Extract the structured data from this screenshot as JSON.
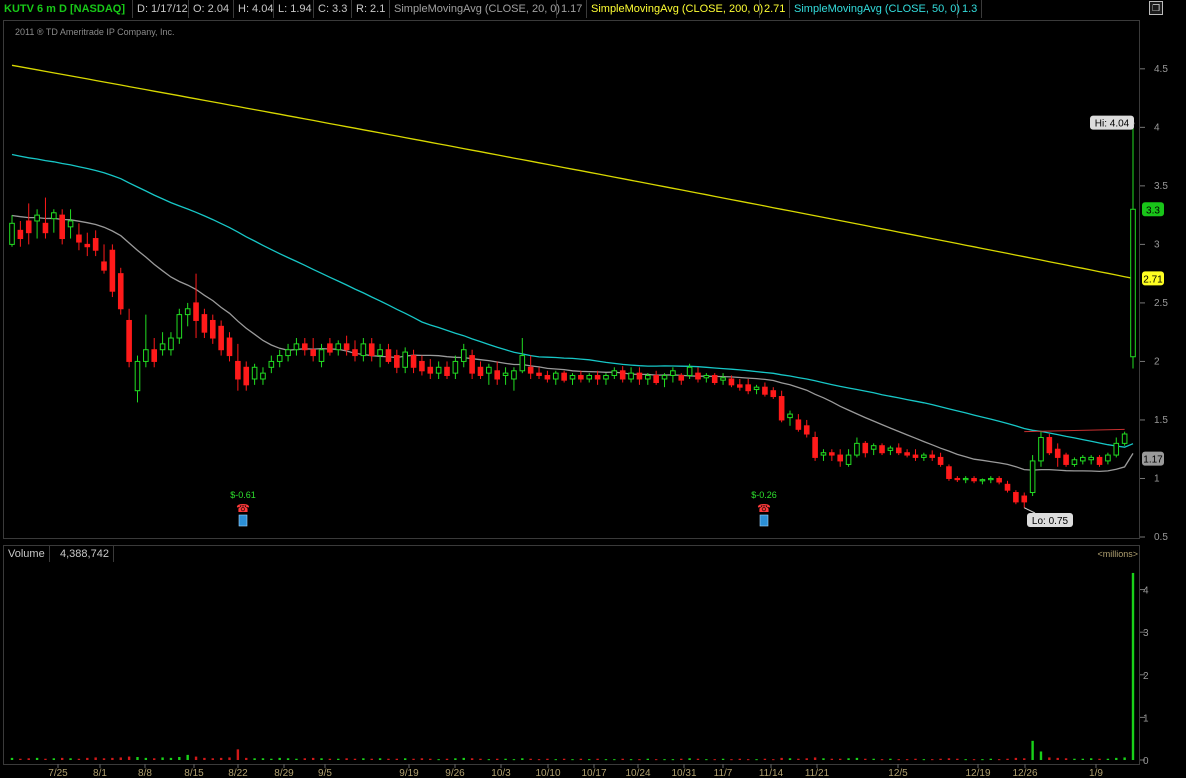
{
  "header": {
    "symbol": "KUTV 6 m D [NASDAQ]",
    "date": "D: 1/17/12",
    "open": "O: 2.04",
    "high": "H: 4.04",
    "low": "L: 1.94",
    "close": "C: 3.3",
    "range": "R: 2.1",
    "sma20_label": "SimpleMovingAvg (CLOSE, 20, 0)",
    "sma20_value": "1.17",
    "sma200_label": "SimpleMovingAvg (CLOSE, 200, 0)",
    "sma200_value": "2.71",
    "sma50_label": "SimpleMovingAvg (CLOSE, 50, 0)",
    "sma50_value": "1.3",
    "restore_icon": "restore-window-icon"
  },
  "colors": {
    "up": "#22dd22",
    "down": "#ff1a1a",
    "sma20": "#9a9a9a",
    "sma50": "#17c7c7",
    "sma200": "#d8d800",
    "volume_up": "#19d119",
    "volume_down": "#d11919",
    "symbol": "#18c818",
    "sma200_label": "#ffff33",
    "sma50_label": "#33dddd"
  },
  "copyright": "2011 ® TD Ameritrade IP Company, Inc.",
  "price_axis": {
    "min": 0.5,
    "max": 4.9,
    "ticks": [
      "0.5",
      "1",
      "1.5",
      "2",
      "2.5",
      "3",
      "3.5",
      "4",
      "4.5"
    ],
    "tags": [
      {
        "label": "Hi: 4.04",
        "value": 4.04
      },
      {
        "label": "3.3",
        "value": 3.3
      },
      {
        "label": "2.71",
        "value": 2.71
      },
      {
        "label": "1.17",
        "value": 1.17
      }
    ],
    "lo_label": "Lo: 0.75"
  },
  "earnings": [
    {
      "label": "$-0.61",
      "date": "8/22",
      "icon": "earnings-phone-icon"
    },
    {
      "label": "$-0.26",
      "date": "11/14",
      "icon": "earnings-phone-icon"
    }
  ],
  "volume_pane": {
    "title": "Volume",
    "value": "4,388,742",
    "units": "<millions>",
    "ticks": [
      "0",
      "1",
      "2",
      "3",
      "4"
    ],
    "max": 4.6
  },
  "x_axis": {
    "labels": [
      "7/25",
      "8/1",
      "8/8",
      "8/15",
      "8/22",
      "8/29",
      "9/5",
      "9/19",
      "9/26",
      "10/3",
      "10/10",
      "10/17",
      "10/24",
      "10/31",
      "11/7",
      "11/14",
      "11/21",
      "12/5",
      "12/19",
      "12/26",
      "1/9"
    ]
  },
  "chart_data": {
    "type": "candlestick",
    "title": "KUTV 6 m D [NASDAQ]",
    "ylim": [
      0.5,
      4.9
    ],
    "x_start": "2011-07-20",
    "candles": [
      [
        3.0,
        3.25,
        2.98,
        3.18
      ],
      [
        3.12,
        3.2,
        2.98,
        3.05
      ],
      [
        3.2,
        3.35,
        3.0,
        3.1
      ],
      [
        3.2,
        3.3,
        3.05,
        3.25
      ],
      [
        3.18,
        3.4,
        3.05,
        3.1
      ],
      [
        3.22,
        3.3,
        3.1,
        3.27
      ],
      [
        3.25,
        3.3,
        3.0,
        3.05
      ],
      [
        3.15,
        3.3,
        3.05,
        3.2
      ],
      [
        3.08,
        3.18,
        2.95,
        3.02
      ],
      [
        3.0,
        3.1,
        2.9,
        2.98
      ],
      [
        3.05,
        3.12,
        2.9,
        2.95
      ],
      [
        2.85,
        3.0,
        2.75,
        2.78
      ],
      [
        2.95,
        3.0,
        2.55,
        2.6
      ],
      [
        2.75,
        2.8,
        2.4,
        2.45
      ],
      [
        2.35,
        2.45,
        1.95,
        2.0
      ],
      [
        1.75,
        2.05,
        1.65,
        2.0
      ],
      [
        2.0,
        2.4,
        1.95,
        2.1
      ],
      [
        2.1,
        2.2,
        1.95,
        2.0
      ],
      [
        2.1,
        2.25,
        2.05,
        2.15
      ],
      [
        2.1,
        2.25,
        2.05,
        2.2
      ],
      [
        2.2,
        2.45,
        2.15,
        2.4
      ],
      [
        2.4,
        2.5,
        2.3,
        2.45
      ],
      [
        2.5,
        2.75,
        2.2,
        2.35
      ],
      [
        2.4,
        2.45,
        2.2,
        2.25
      ],
      [
        2.35,
        2.4,
        2.15,
        2.2
      ],
      [
        2.3,
        2.35,
        2.05,
        2.1
      ],
      [
        2.2,
        2.25,
        2.0,
        2.05
      ],
      [
        2.0,
        2.15,
        1.75,
        1.85
      ],
      [
        1.95,
        2.0,
        1.75,
        1.8
      ],
      [
        1.85,
        1.98,
        1.8,
        1.95
      ],
      [
        1.85,
        1.95,
        1.8,
        1.9
      ],
      [
        1.95,
        2.05,
        1.9,
        2.0
      ],
      [
        2.0,
        2.1,
        1.95,
        2.05
      ],
      [
        2.05,
        2.15,
        2.0,
        2.1
      ],
      [
        2.1,
        2.2,
        2.05,
        2.15
      ],
      [
        2.15,
        2.2,
        2.05,
        2.1
      ],
      [
        2.1,
        2.2,
        2.0,
        2.05
      ],
      [
        2.0,
        2.15,
        1.95,
        2.1
      ],
      [
        2.15,
        2.2,
        2.05,
        2.08
      ],
      [
        2.1,
        2.18,
        2.05,
        2.15
      ],
      [
        2.15,
        2.22,
        2.05,
        2.1
      ],
      [
        2.1,
        2.18,
        2.0,
        2.05
      ],
      [
        2.05,
        2.2,
        2.0,
        2.15
      ],
      [
        2.15,
        2.2,
        2.0,
        2.05
      ],
      [
        2.05,
        2.15,
        1.95,
        2.1
      ],
      [
        2.1,
        2.15,
        1.98,
        2.0
      ],
      [
        2.05,
        2.1,
        1.9,
        1.95
      ],
      [
        1.95,
        2.12,
        1.9,
        2.08
      ],
      [
        2.05,
        2.1,
        1.9,
        1.95
      ],
      [
        2.0,
        2.05,
        1.88,
        1.92
      ],
      [
        1.95,
        2.02,
        1.85,
        1.9
      ],
      [
        1.9,
        2.0,
        1.85,
        1.95
      ],
      [
        1.95,
        2.0,
        1.85,
        1.88
      ],
      [
        1.9,
        2.05,
        1.85,
        2.0
      ],
      [
        2.0,
        2.15,
        1.95,
        2.1
      ],
      [
        2.05,
        2.1,
        1.85,
        1.9
      ],
      [
        1.95,
        2.0,
        1.85,
        1.88
      ],
      [
        1.9,
        1.98,
        1.8,
        1.95
      ],
      [
        1.92,
        2.0,
        1.8,
        1.85
      ],
      [
        1.88,
        1.95,
        1.8,
        1.9
      ],
      [
        1.85,
        1.95,
        1.75,
        1.92
      ],
      [
        1.92,
        2.2,
        1.9,
        2.05
      ],
      [
        1.95,
        2.05,
        1.85,
        1.9
      ],
      [
        1.9,
        1.95,
        1.85,
        1.88
      ],
      [
        1.88,
        1.92,
        1.82,
        1.85
      ],
      [
        1.85,
        1.92,
        1.8,
        1.9
      ],
      [
        1.9,
        1.92,
        1.82,
        1.84
      ],
      [
        1.85,
        1.9,
        1.8,
        1.88
      ],
      [
        1.88,
        1.92,
        1.82,
        1.85
      ],
      [
        1.85,
        1.9,
        1.82,
        1.88
      ],
      [
        1.88,
        1.92,
        1.8,
        1.85
      ],
      [
        1.85,
        1.9,
        1.8,
        1.88
      ],
      [
        1.88,
        1.95,
        1.85,
        1.92
      ],
      [
        1.92,
        1.96,
        1.82,
        1.85
      ],
      [
        1.85,
        1.95,
        1.82,
        1.9
      ],
      [
        1.9,
        1.95,
        1.8,
        1.85
      ],
      [
        1.85,
        1.9,
        1.8,
        1.88
      ],
      [
        1.88,
        1.92,
        1.8,
        1.82
      ],
      [
        1.85,
        1.9,
        1.78,
        1.88
      ],
      [
        1.88,
        1.95,
        1.82,
        1.92
      ],
      [
        1.88,
        1.9,
        1.8,
        1.84
      ],
      [
        1.88,
        1.98,
        1.85,
        1.95
      ],
      [
        1.9,
        1.95,
        1.82,
        1.85
      ],
      [
        1.86,
        1.9,
        1.82,
        1.88
      ],
      [
        1.88,
        1.9,
        1.8,
        1.82
      ],
      [
        1.84,
        1.9,
        1.8,
        1.86
      ],
      [
        1.85,
        1.88,
        1.78,
        1.8
      ],
      [
        1.8,
        1.85,
        1.75,
        1.78
      ],
      [
        1.8,
        1.85,
        1.72,
        1.75
      ],
      [
        1.76,
        1.8,
        1.72,
        1.78
      ],
      [
        1.78,
        1.82,
        1.7,
        1.72
      ],
      [
        1.75,
        1.78,
        1.68,
        1.7
      ],
      [
        1.7,
        1.75,
        1.48,
        1.5
      ],
      [
        1.52,
        1.58,
        1.45,
        1.55
      ],
      [
        1.5,
        1.55,
        1.4,
        1.42
      ],
      [
        1.45,
        1.5,
        1.35,
        1.38
      ],
      [
        1.35,
        1.4,
        1.15,
        1.18
      ],
      [
        1.2,
        1.25,
        1.15,
        1.22
      ],
      [
        1.22,
        1.25,
        1.15,
        1.2
      ],
      [
        1.2,
        1.25,
        1.1,
        1.15
      ],
      [
        1.12,
        1.25,
        1.1,
        1.2
      ],
      [
        1.2,
        1.35,
        1.18,
        1.3
      ],
      [
        1.3,
        1.32,
        1.18,
        1.22
      ],
      [
        1.25,
        1.3,
        1.2,
        1.28
      ],
      [
        1.28,
        1.3,
        1.2,
        1.22
      ],
      [
        1.24,
        1.28,
        1.2,
        1.26
      ],
      [
        1.26,
        1.3,
        1.2,
        1.22
      ],
      [
        1.22,
        1.25,
        1.18,
        1.2
      ],
      [
        1.2,
        1.25,
        1.15,
        1.18
      ],
      [
        1.18,
        1.22,
        1.15,
        1.2
      ],
      [
        1.2,
        1.24,
        1.15,
        1.18
      ],
      [
        1.18,
        1.22,
        1.1,
        1.12
      ],
      [
        1.1,
        1.12,
        0.98,
        1.0
      ],
      [
        1.0,
        1.02,
        0.97,
        0.99
      ],
      [
        0.99,
        1.02,
        0.96,
        1.0
      ],
      [
        1.0,
        1.02,
        0.96,
        0.98
      ],
      [
        0.98,
        1.0,
        0.95,
        0.99
      ],
      [
        0.99,
        1.02,
        0.96,
        1.0
      ],
      [
        1.0,
        1.02,
        0.95,
        0.97
      ],
      [
        0.95,
        0.98,
        0.88,
        0.9
      ],
      [
        0.88,
        0.9,
        0.78,
        0.8
      ],
      [
        0.85,
        0.88,
        0.75,
        0.8
      ],
      [
        0.88,
        1.2,
        0.85,
        1.15
      ],
      [
        1.15,
        1.4,
        1.1,
        1.35
      ],
      [
        1.35,
        1.38,
        1.2,
        1.22
      ],
      [
        1.25,
        1.3,
        1.1,
        1.18
      ],
      [
        1.2,
        1.22,
        1.1,
        1.12
      ],
      [
        1.12,
        1.18,
        1.1,
        1.16
      ],
      [
        1.15,
        1.2,
        1.12,
        1.18
      ],
      [
        1.16,
        1.2,
        1.12,
        1.18
      ],
      [
        1.18,
        1.2,
        1.1,
        1.12
      ],
      [
        1.15,
        1.22,
        1.12,
        1.2
      ],
      [
        1.2,
        1.35,
        1.18,
        1.3
      ],
      [
        1.3,
        1.4,
        1.28,
        1.38
      ],
      [
        2.04,
        4.04,
        1.94,
        3.3
      ]
    ],
    "volume_millions": [
      0.05,
      0.03,
      0.04,
      0.05,
      0.03,
      0.04,
      0.05,
      0.04,
      0.03,
      0.05,
      0.06,
      0.04,
      0.05,
      0.06,
      0.08,
      0.07,
      0.05,
      0.04,
      0.06,
      0.05,
      0.07,
      0.12,
      0.08,
      0.05,
      0.04,
      0.05,
      0.06,
      0.25,
      0.05,
      0.04,
      0.04,
      0.03,
      0.05,
      0.04,
      0.03,
      0.04,
      0.05,
      0.04,
      0.03,
      0.03,
      0.04,
      0.03,
      0.04,
      0.03,
      0.04,
      0.03,
      0.03,
      0.04,
      0.03,
      0.04,
      0.03,
      0.02,
      0.03,
      0.04,
      0.05,
      0.04,
      0.03,
      0.02,
      0.03,
      0.03,
      0.02,
      0.04,
      0.03,
      0.02,
      0.03,
      0.02,
      0.03,
      0.02,
      0.03,
      0.02,
      0.03,
      0.02,
      0.02,
      0.03,
      0.02,
      0.02,
      0.03,
      0.02,
      0.02,
      0.02,
      0.03,
      0.04,
      0.03,
      0.02,
      0.02,
      0.03,
      0.02,
      0.03,
      0.02,
      0.02,
      0.03,
      0.02,
      0.05,
      0.04,
      0.03,
      0.04,
      0.06,
      0.04,
      0.03,
      0.03,
      0.04,
      0.05,
      0.03,
      0.03,
      0.02,
      0.03,
      0.02,
      0.02,
      0.03,
      0.02,
      0.02,
      0.03,
      0.04,
      0.03,
      0.02,
      0.02,
      0.02,
      0.03,
      0.02,
      0.03,
      0.05,
      0.04,
      0.45,
      0.2,
      0.06,
      0.05,
      0.04,
      0.03,
      0.03,
      0.04,
      0.03,
      0.03,
      0.05,
      0.06,
      4.39
    ],
    "sma20": {
      "start_value": 3.25,
      "end_value": 1.17
    },
    "sma50": {
      "start_value": 3.78,
      "end_value": 1.3
    },
    "sma200": {
      "start_value": 4.53,
      "end_value": 2.71
    }
  }
}
